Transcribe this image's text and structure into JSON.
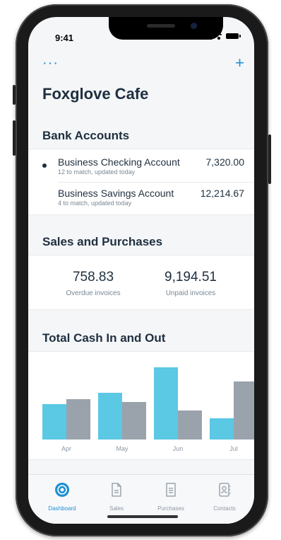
{
  "status": {
    "time": "9:41"
  },
  "topbar": {
    "menu_icon": "more-dots-icon",
    "add_icon": "plus-icon",
    "menu_glyph": "···",
    "add_glyph": "+"
  },
  "org_name": "Foxglove Cafe",
  "bank": {
    "title": "Bank Accounts",
    "accounts": [
      {
        "name": "Business Checking Account",
        "sub": "12 to match, updated today",
        "value": "7,320.00",
        "selected": true
      },
      {
        "name": "Business Savings Account",
        "sub": "4 to match, updated today",
        "value": "12,214.67",
        "selected": false
      }
    ]
  },
  "sales": {
    "title": "Sales and Purchases",
    "stats": [
      {
        "value": "758.83",
        "label": "Overdue invoices"
      },
      {
        "value": "9,194.51",
        "label": "Unpaid invoices"
      }
    ]
  },
  "cash": {
    "title": "Total Cash In and Out"
  },
  "chart_data": {
    "type": "bar",
    "categories": [
      "Apr",
      "May",
      "Jun",
      "Jul"
    ],
    "series": [
      {
        "values": [
          50,
          66,
          102,
          30
        ],
        "color": "#5bc8e4"
      },
      {
        "values": [
          57,
          53,
          41,
          82
        ],
        "color": "#9aa3ab"
      }
    ],
    "ylim": [
      0,
      110
    ],
    "grid": false
  },
  "tabs": [
    {
      "label": "Dashboard",
      "icon": "dashboard-icon",
      "active": true
    },
    {
      "label": "Sales",
      "icon": "sales-document-icon",
      "active": false
    },
    {
      "label": "Purchases",
      "icon": "purchases-document-icon",
      "active": false
    },
    {
      "label": "Contacts",
      "icon": "contacts-icon",
      "active": false
    }
  ],
  "colors": {
    "accent": "#1e90d4",
    "text": "#1f2f3f",
    "muted": "#7a8894",
    "bar_in": "#5bc8e4",
    "bar_out": "#9aa3ab"
  }
}
